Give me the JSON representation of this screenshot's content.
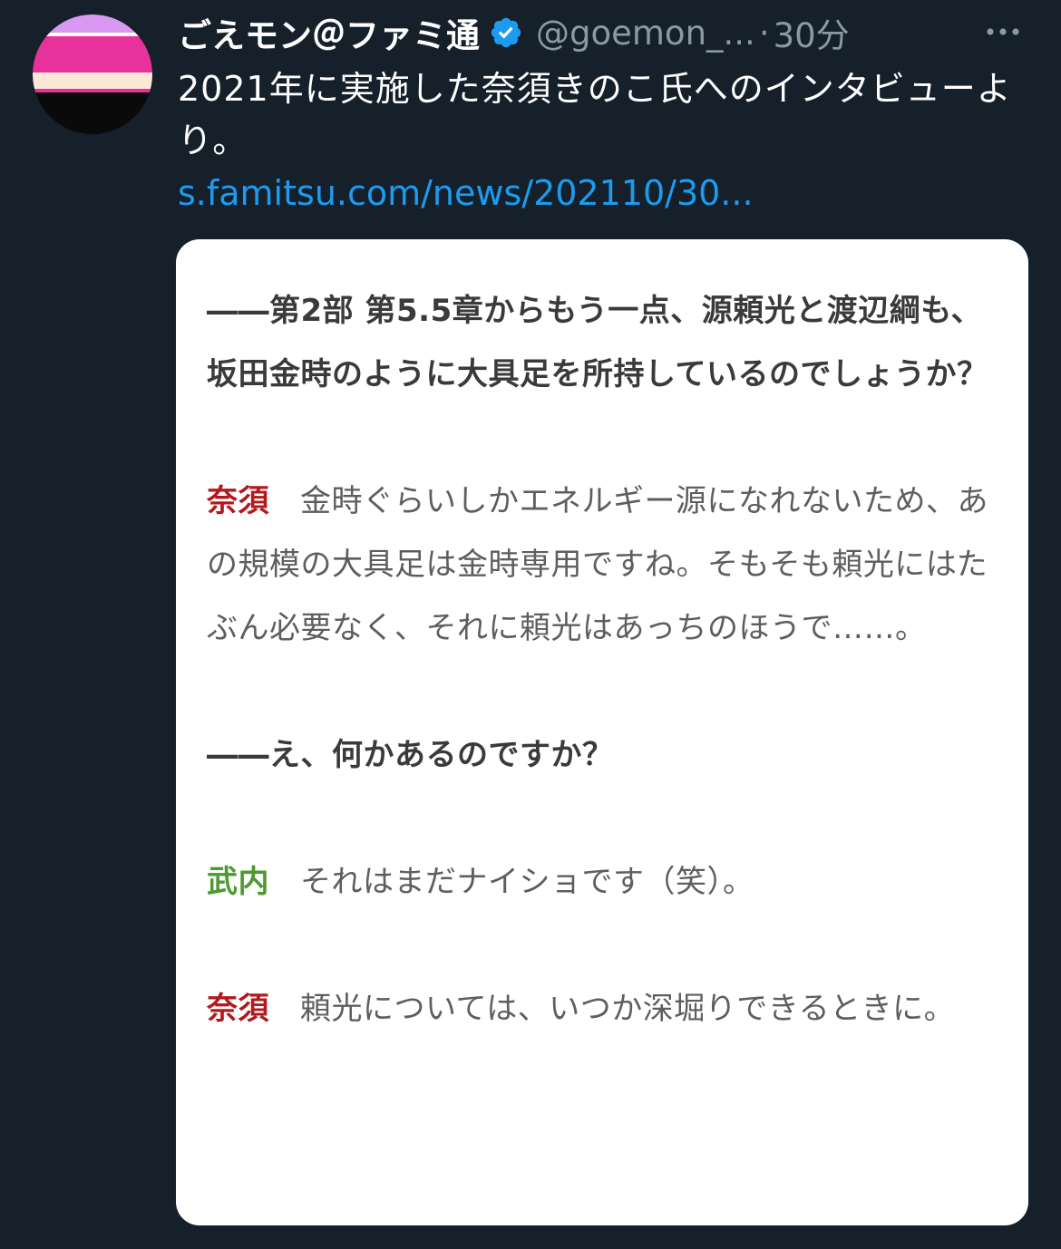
{
  "tweet": {
    "display_name": "ごえモン＠ファミ通",
    "handle": "@goemon_...",
    "separator": "·",
    "time": "30分",
    "text": "2021年に実施した奈須きのこ氏へのインタビューより。",
    "link": "s.famitsu.com/news/202110/30..."
  },
  "avatar": {
    "stripes": [
      "#d999f2",
      "#ffffff",
      "#e8319b",
      "#fbe9d6",
      "#e8319b",
      "#0a0a0a"
    ]
  },
  "icons": {
    "verified": "verified-badge-icon",
    "more": "more-options-icon"
  },
  "colors": {
    "background": "#15202b",
    "link": "#1d9bf0",
    "verified": "#1d9bf0",
    "speaker_nasu": "#b3191c",
    "speaker_takeuchi": "#4e9a2f"
  },
  "card": {
    "question1": "――第2部 第5.5章からもう一点、源頼光と渡辺綱も、坂田金時のように大具足を所持しているのでしょうか？",
    "answer1": {
      "speaker": "奈須",
      "text": "金時ぐらいしかエネルギー源になれないため、あの規模の大具足は金時専用ですね。そもそも頼光にはたぶん必要なく、それに頼光はあっちのほうで……。"
    },
    "question2": "――え、何かあるのですか？",
    "answer2": {
      "speaker": "武内",
      "text": "それはまだナイショです（笑）。"
    },
    "answer3": {
      "speaker": "奈須",
      "text": "頼光については、いつか深堀りできるときに。"
    }
  }
}
